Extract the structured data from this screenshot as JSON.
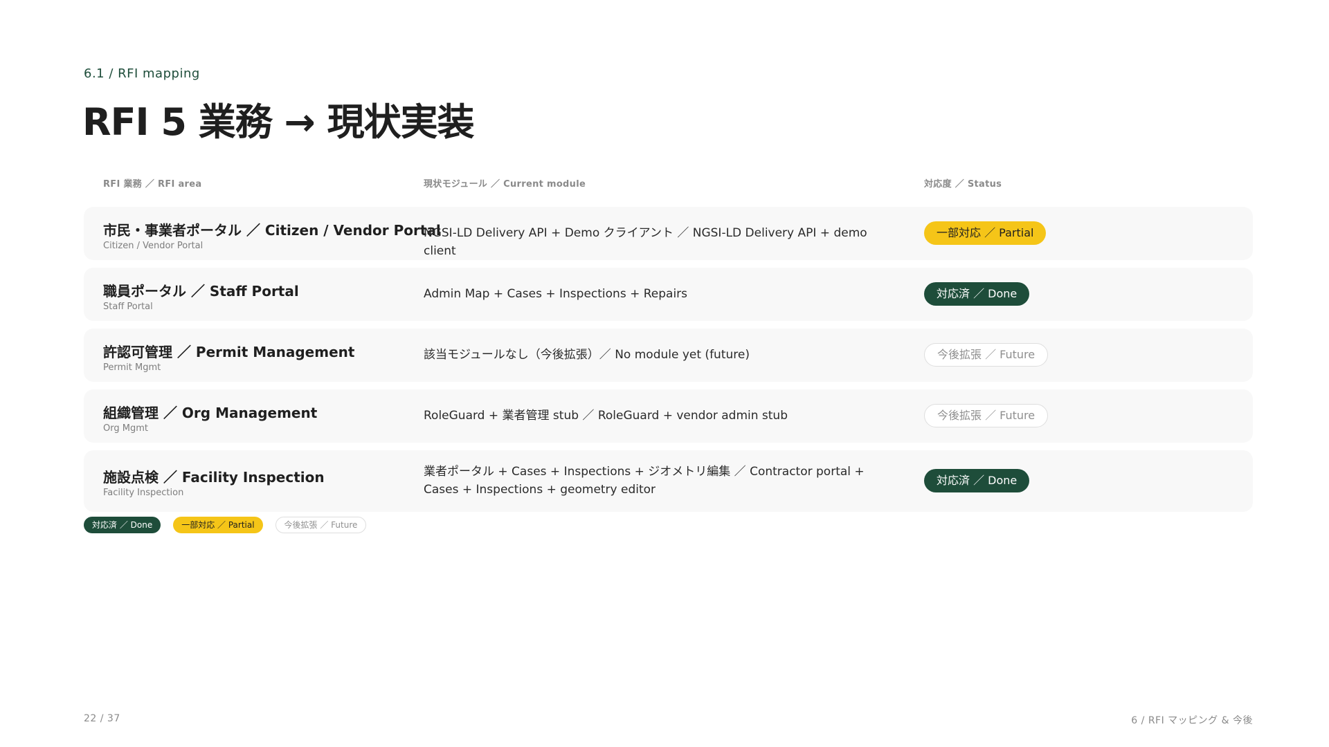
{
  "header": {
    "eyebrow": "6.1 / RFI mapping",
    "title": "RFI 5 業務 → 現状実装"
  },
  "table": {
    "columns": {
      "area": "RFI 業務 ／ RFI area",
      "module": "現状モジュール ／ Current module",
      "status": "対応度 ／ Status"
    },
    "rows": [
      {
        "area": "市民・事業者ポータル ／ Citizen / Vendor Portal",
        "area_sub": "Citizen / Vendor Portal",
        "module": "NGSI-LD Delivery API + Demo クライアント ／ NGSI-LD Delivery API + demo client",
        "status": "一部対応 ／ Partial"
      },
      {
        "area": "職員ポータル ／ Staff Portal",
        "area_sub": "Staff Portal",
        "module": "Admin Map + Cases + Inspections + Repairs",
        "status": "対応済 ／ Done"
      },
      {
        "area": "許認可管理 ／ Permit Management",
        "area_sub": "Permit Mgmt",
        "module": "該当モジュールなし（今後拡張）／ No module yet (future)",
        "status": "今後拡張 ／ Future"
      },
      {
        "area": "組織管理 ／ Org Management",
        "area_sub": "Org Mgmt",
        "module": "RoleGuard + 業者管理 stub ／ RoleGuard + vendor admin stub",
        "status": "今後拡張 ／ Future"
      },
      {
        "area": "施設点検 ／ Facility Inspection",
        "area_sub": "Facility Inspection",
        "module": "業者ポータル + Cases + Inspections + ジオメトリ編集 ／ Contractor portal + Cases + Inspections + geometry editor",
        "status": "対応済 ／ Done"
      }
    ]
  },
  "legend": {
    "done": "対応済 ／ Done",
    "partial": "一部対応 ／ Partial",
    "future": "今後拡張 ／ Future"
  },
  "footer": {
    "page": "22 / 37",
    "section": "6 / RFI マッピング & 今後"
  },
  "colors": {
    "accent_green": "#1e4d3a",
    "accent_yellow": "#f5c518",
    "row_bg": "#f8f8f8"
  }
}
